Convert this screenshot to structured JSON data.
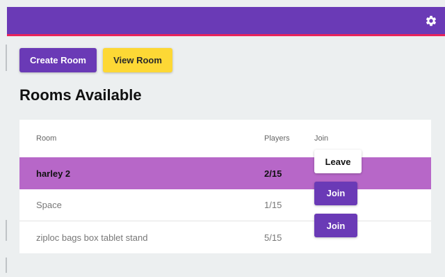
{
  "toolbar": {
    "create_label": "Create Room",
    "view_label": "View Room"
  },
  "page": {
    "title": "Rooms Available"
  },
  "table": {
    "headers": {
      "room": "Room",
      "players": "Players",
      "join": "Join"
    },
    "rows": [
      {
        "room": "harley 2",
        "players": "2/15",
        "action": "Leave",
        "joined": true
      },
      {
        "room": "Space",
        "players": "1/15",
        "action": "Join",
        "joined": false
      },
      {
        "room": "ziploc bags box tablet stand",
        "players": "5/15",
        "action": "Join",
        "joined": false
      }
    ]
  },
  "colors": {
    "appbar": "#6a3ab6",
    "appbar_accent": "#e8245b",
    "primary_button": "#6a3ab6",
    "secondary_button": "#fdd835",
    "selected_row": "#b767c8",
    "background": "#eceff0"
  },
  "icons": {
    "settings": "gear-icon"
  }
}
